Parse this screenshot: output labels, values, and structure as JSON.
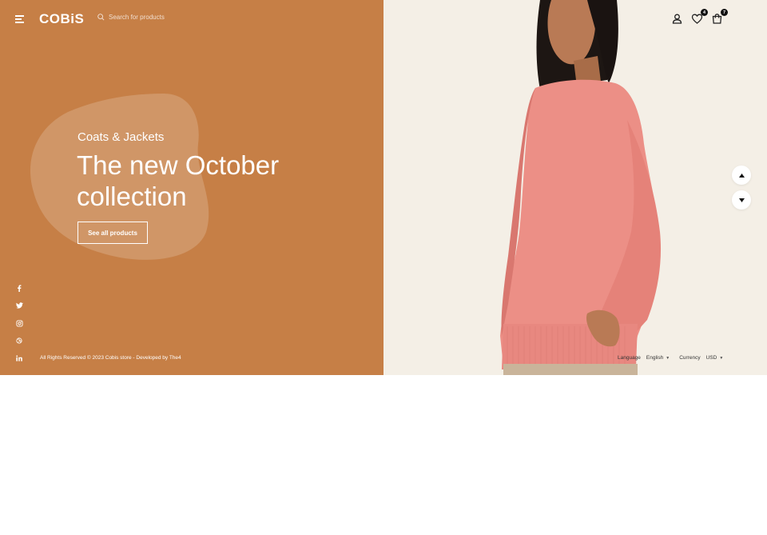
{
  "header": {
    "logo": "COBiS",
    "search_placeholder": "Search for products",
    "wishlist_count": "4",
    "cart_count": "7"
  },
  "hero": {
    "subtitle": "Coats & Jackets",
    "title": "The new October collection",
    "cta_label": "See all products",
    "bg_color": "#c67f46",
    "right_bg_color": "#f4efe6"
  },
  "social": [
    {
      "icon": "facebook-icon",
      "glyph": "f"
    },
    {
      "icon": "twitter-icon",
      "glyph": "t"
    },
    {
      "icon": "instagram-icon",
      "glyph": "ig"
    },
    {
      "icon": "dribbble-icon",
      "glyph": "d"
    },
    {
      "icon": "linkedin-icon",
      "glyph": "in"
    }
  ],
  "footer": {
    "copyright": "All Rights Reserved © 2023 Cobis store - Developed by The4",
    "language_label": "Language",
    "language_value": "English",
    "currency_label": "Currency",
    "currency_value": "USD"
  }
}
